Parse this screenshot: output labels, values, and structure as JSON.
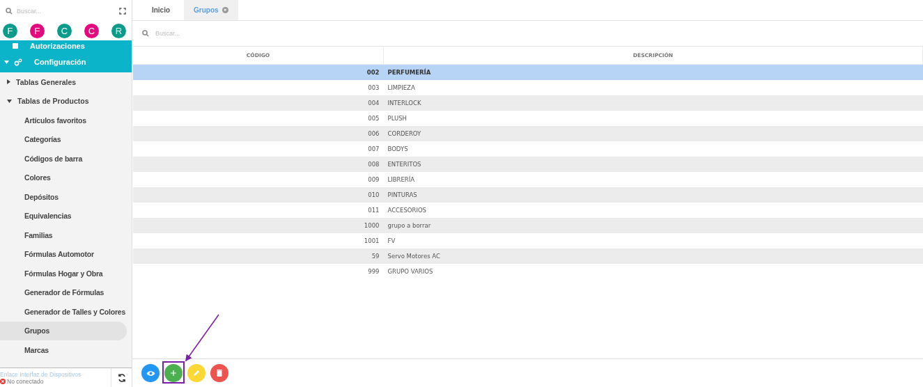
{
  "sidebar": {
    "search": {
      "placeholder": "Buscar..."
    },
    "users": [
      {
        "initial": "F",
        "color": "#0b9b8b"
      },
      {
        "initial": "F",
        "color": "#e5097f"
      },
      {
        "initial": "C",
        "color": "#0b9b8b"
      },
      {
        "initial": "C",
        "color": "#e5097f"
      },
      {
        "initial": "R",
        "color": "#0b9b8b"
      }
    ],
    "menu": [
      {
        "label": "Autorizaciones",
        "kind": "section"
      },
      {
        "label": "Configuración",
        "kind": "section",
        "expanded": true,
        "children": [
          {
            "label": "Tablas Generales",
            "expanded": false
          },
          {
            "label": "Tablas de Productos",
            "expanded": true,
            "children": [
              {
                "label": "Artículos favoritos",
                "selected": false
              },
              {
                "label": "Categorías",
                "selected": false
              },
              {
                "label": "Códigos de barra",
                "selected": false
              },
              {
                "label": "Colores",
                "selected": false
              },
              {
                "label": "Depósitos",
                "selected": false
              },
              {
                "label": "Equivalencias",
                "selected": false
              },
              {
                "label": "Familias",
                "selected": false
              },
              {
                "label": "Fórmulas Automotor",
                "selected": false
              },
              {
                "label": "Fórmulas Hogar y Obra",
                "selected": false
              },
              {
                "label": "Generador de Fórmulas",
                "selected": false
              },
              {
                "label": "Generador de Talles y Colores",
                "selected": false
              },
              {
                "label": "Grupos",
                "selected": true
              },
              {
                "label": "Marcas",
                "selected": false
              }
            ]
          }
        ]
      }
    ],
    "device_link": "Enlace Interfaz de Dispositivos",
    "connection": {
      "status": "No conectado",
      "connected": false
    }
  },
  "tabs": [
    {
      "label": "Inicio",
      "selected": false,
      "closable": false
    },
    {
      "label": "Grupos",
      "selected": true,
      "closable": true
    }
  ],
  "search": {
    "placeholder": "Buscar..."
  },
  "table": {
    "columns": [
      "CÓDIGO",
      "DESCRIPCIÓN"
    ],
    "rows": [
      {
        "cells": [
          "002",
          "PERFUMERÍA"
        ],
        "selected": true
      },
      {
        "cells": [
          "003",
          "LIMPIEZA"
        ],
        "selected": false
      },
      {
        "cells": [
          "004",
          "INTERLOCK"
        ],
        "selected": false
      },
      {
        "cells": [
          "005",
          "PLUSH"
        ],
        "selected": false
      },
      {
        "cells": [
          "006",
          "CORDEROY"
        ],
        "selected": false
      },
      {
        "cells": [
          "007",
          "BODYS"
        ],
        "selected": false
      },
      {
        "cells": [
          "008",
          "ENTERITOS"
        ],
        "selected": false
      },
      {
        "cells": [
          "009",
          "LIBRERÍA"
        ],
        "selected": false
      },
      {
        "cells": [
          "010",
          "PINTURAS"
        ],
        "selected": false
      },
      {
        "cells": [
          "011",
          "ACCESORIOS"
        ],
        "selected": false
      },
      {
        "cells": [
          "1000",
          "grupo a borrar"
        ],
        "selected": false
      },
      {
        "cells": [
          "1001",
          "FV"
        ],
        "selected": false
      },
      {
        "cells": [
          "59",
          "Servo Motores AC"
        ],
        "selected": false
      },
      {
        "cells": [
          "999",
          "GRUPO VARIOS"
        ],
        "selected": false
      }
    ]
  },
  "actions": [
    {
      "kind": "view",
      "annotated": false
    },
    {
      "kind": "add",
      "annotated": true
    },
    {
      "kind": "edit",
      "annotated": false
    },
    {
      "kind": "delete",
      "annotated": false
    }
  ]
}
